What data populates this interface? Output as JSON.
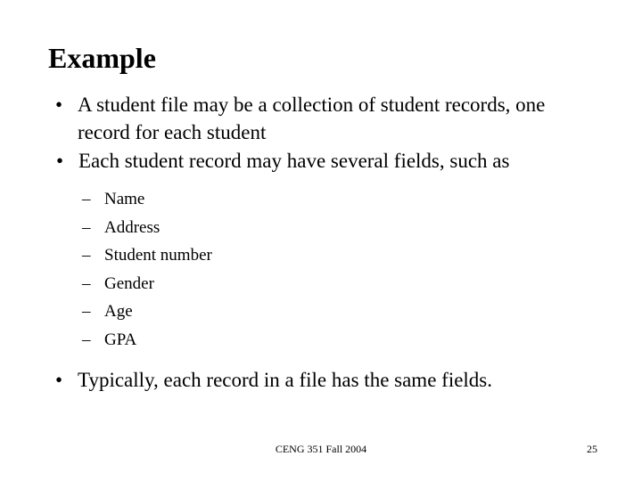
{
  "slide": {
    "title": "Example",
    "bullet_marker": "•",
    "sub_bullet_marker": "–",
    "bullets": [
      {
        "text": "A student file may be a collection of student records, one record for each student"
      },
      {
        "text": "Each student record may have several fields, such as"
      }
    ],
    "sub_bullets": [
      {
        "label": "Name"
      },
      {
        "label": "Address"
      },
      {
        "label": "Student number"
      },
      {
        "label": "Gender"
      },
      {
        "label": "Age"
      },
      {
        "label": "GPA"
      }
    ],
    "closing_bullet": {
      "text": "Typically, each record in a file has the same fields."
    },
    "footer": {
      "note": "CENG 351 Fall 2004",
      "page_number": "25"
    },
    "colors": {
      "background": "#ffffff",
      "text": "#000000"
    }
  }
}
